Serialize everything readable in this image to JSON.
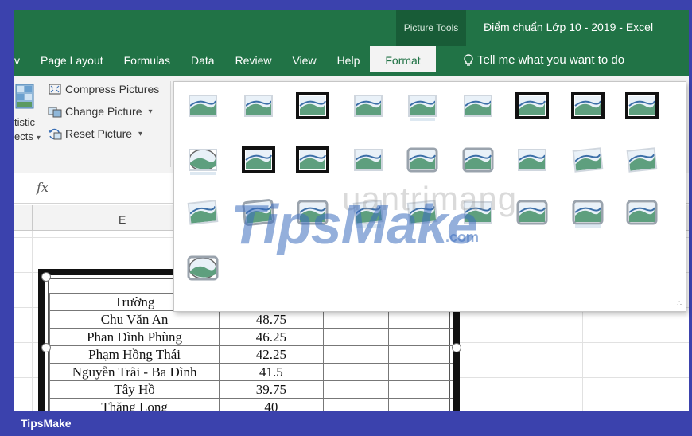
{
  "window": {
    "context_group": "Picture Tools",
    "title": "Điểm chuẩn Lớp 10 - 2019  -  Excel"
  },
  "tabs": [
    {
      "label": "v"
    },
    {
      "label": "Page Layout"
    },
    {
      "label": "Formulas"
    },
    {
      "label": "Data"
    },
    {
      "label": "Review"
    },
    {
      "label": "View"
    },
    {
      "label": "Help"
    },
    {
      "label": "Format",
      "active": true
    }
  ],
  "tell_me": "Tell me what you want to do",
  "ribbon": {
    "artistic_label_1": "tistic",
    "artistic_label_2": "ects",
    "compress": "Compress Pictures",
    "change": "Change Picture",
    "reset": "Reset Picture"
  },
  "formula_bar": {
    "fx": "fx"
  },
  "columns": {
    "e": "E"
  },
  "table": {
    "rows": [
      [
        "Trường",
        "",
        "",
        ""
      ],
      [
        "Chu Văn An",
        "48.75",
        "",
        ""
      ],
      [
        "Phan Đình Phùng",
        "46.25",
        "",
        ""
      ],
      [
        "Phạm Hồng Thái",
        "42.25",
        "",
        ""
      ],
      [
        "Nguyễn Trãi - Ba Đình",
        "41.5",
        "",
        ""
      ],
      [
        "Tây Hồ",
        "39.75",
        "",
        ""
      ],
      [
        "Thăng Long",
        "40",
        "",
        ""
      ]
    ]
  },
  "gallery": {
    "styles": [
      "simple-frame-white",
      "soft-edge-rectangle",
      "simple-frame-black-grey",
      "drop-shadow-rectangle",
      "reflected-rounded",
      "soft-edge",
      "double-frame-black",
      "thick-matte-black",
      "simple-frame-black",
      "oval-reflected",
      "thin-black-frame",
      "thick-black-frame",
      "rounded-rectangle",
      "bevel-rectangle",
      "beveled-frame",
      "center-shadow",
      "rotated-white",
      "perspective-shadow",
      "relaxed-perspective",
      "bevel-perspective",
      "metal-frame",
      "reflected-perspective",
      "rotated-perspective",
      "moderate-frame",
      "beveled-dark",
      "reflected-bevel-white",
      "metal-rounded",
      "metal-oval"
    ]
  },
  "watermark": {
    "main": "TipsMake",
    "suffix": ".com",
    "secondary": "uantrimang"
  },
  "brand": "TipsMake",
  "colors": {
    "excel_green": "#217346",
    "frame_blue": "#3b42ad",
    "ribbon_gray": "#f3f3f3"
  }
}
